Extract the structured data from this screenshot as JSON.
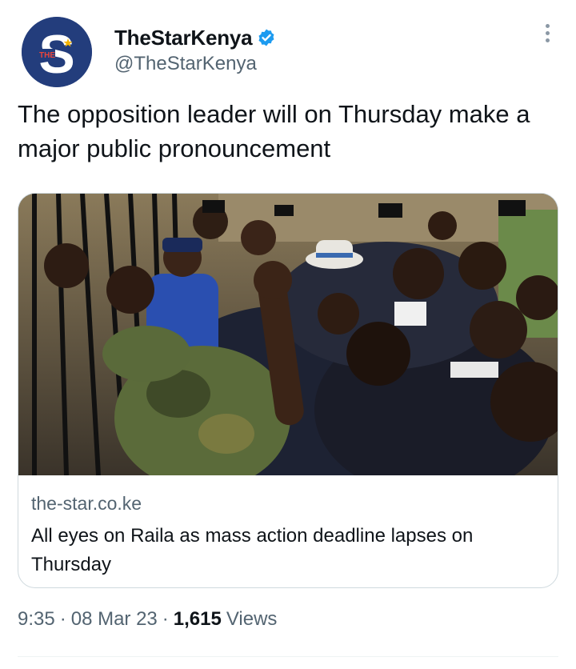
{
  "author": {
    "display_name": "TheStarKenya",
    "handle": "@TheStarKenya",
    "verified": true,
    "avatar_letter": "S",
    "avatar_small_text": "THE",
    "avatar_color": "#233d7c",
    "verified_color": "#1d9bf0"
  },
  "tweet": {
    "text": "The opposition leader will on Thursday make a major public pronouncement"
  },
  "card": {
    "domain": "the-star.co.ke",
    "title": "All eyes on Raila as mass action deadline lapses on Thursday",
    "image_description_icon": "news-photo"
  },
  "meta": {
    "time": "9:35",
    "separator": "·",
    "date": "08 Mar 23",
    "views_count": "1,615",
    "views_label": "Views"
  },
  "icons": {
    "more": "more-vertical-icon",
    "verified": "verified-badge-icon"
  }
}
